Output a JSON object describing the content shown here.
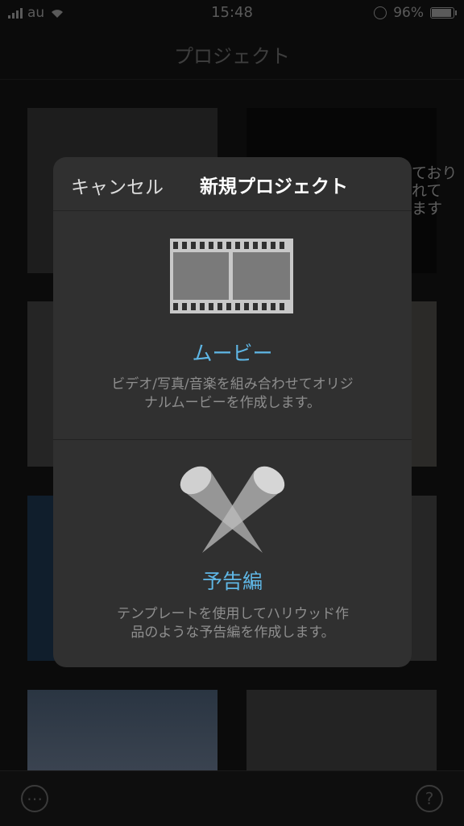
{
  "status_bar": {
    "carrier": "au",
    "time": "15:48",
    "battery": "96%"
  },
  "nav": {
    "title": "プロジェクト"
  },
  "background": {
    "ghost_text": "ており\nれて\nます"
  },
  "toolbar": {
    "more_symbol": "⋯",
    "help_symbol": "?"
  },
  "modal": {
    "cancel_label": "キャンセル",
    "title": "新規プロジェクト",
    "options": [
      {
        "icon": "film-strip-icon",
        "label": "ムービー",
        "description": "ビデオ/写真/音楽を組み合わせてオリジナルムービーを作成します。"
      },
      {
        "icon": "spotlights-icon",
        "label": "予告編",
        "description": "テンプレートを使用してハリウッド作品のような予告編を作成します。"
      }
    ]
  },
  "colors": {
    "accent": "#5fb7e6",
    "modal_bg": "#303030",
    "backdrop": "#0b0b0b"
  }
}
